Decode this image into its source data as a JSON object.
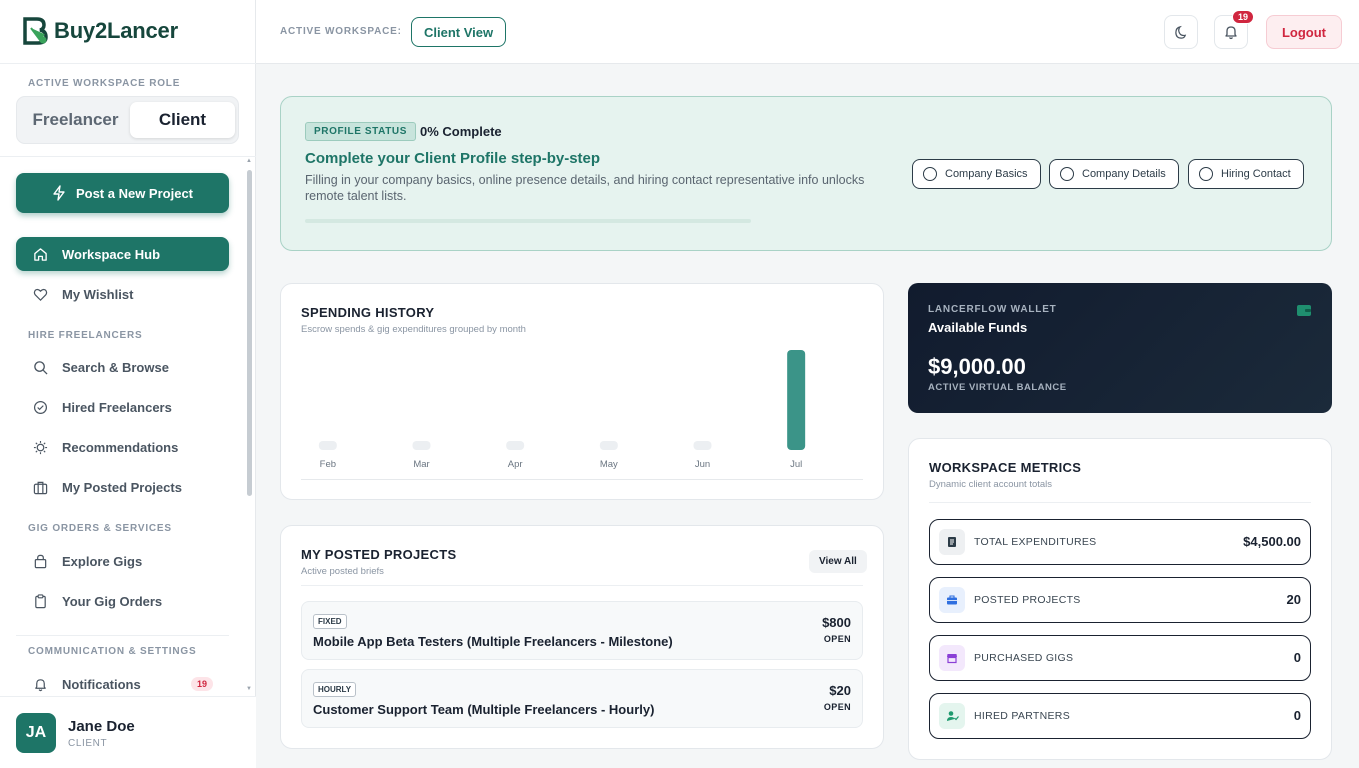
{
  "brand": {
    "name": "Buy2Lancer"
  },
  "sidebar": {
    "role_label": "ACTIVE WORKSPACE ROLE",
    "roles": [
      "Freelancer",
      "Client"
    ],
    "active_role": "Client",
    "post_project": "Post a New Project",
    "items": [
      {
        "label": "Workspace Hub",
        "icon": "home-icon",
        "active": true
      },
      {
        "label": "My Wishlist",
        "icon": "heart-icon"
      },
      {
        "label": "Search & Browse",
        "icon": "search-icon"
      },
      {
        "label": "Hired Freelancers",
        "icon": "check-circle-icon"
      },
      {
        "label": "Recommendations",
        "icon": "lightbulb-icon"
      },
      {
        "label": "My Posted Projects",
        "icon": "briefcase-icon"
      },
      {
        "label": "Explore Gigs",
        "icon": "shopping-bag-icon"
      },
      {
        "label": "Your Gig Orders",
        "icon": "clipboard-icon"
      },
      {
        "label": "Notifications",
        "icon": "bell-icon",
        "badge": "19"
      }
    ],
    "sections": {
      "hire": "HIRE FREELANCERS",
      "gig": "GIG ORDERS & SERVICES",
      "comm": "COMMUNICATION & SETTINGS"
    },
    "user": {
      "initials": "JA",
      "name": "Jane Doe",
      "role": "CLIENT"
    }
  },
  "topbar": {
    "workspace_label": "ACTIVE WORKSPACE:",
    "workspace_value": "Client View",
    "notification_count": "19",
    "logout": "Logout"
  },
  "profile": {
    "tag": "PROFILE STATUS",
    "percent": "0% Complete",
    "progress": 0,
    "title": "Complete your Client Profile step-by-step",
    "description": "Filling in your company basics, online presence details, and hiring contact representative info unlocks remote talent lists.",
    "steps": [
      "Company Basics",
      "Company Details",
      "Hiring Contact"
    ]
  },
  "spending": {
    "title": "SPENDING HISTORY",
    "subtitle": "Escrow spends & gig expenditures grouped by month"
  },
  "chart_data": {
    "type": "bar",
    "categories": [
      "Feb",
      "Mar",
      "Apr",
      "May",
      "Jun",
      "Jul"
    ],
    "values": [
      0,
      0,
      0,
      0,
      0,
      4500
    ],
    "title": "SPENDING HISTORY",
    "colors": {
      "bar": "#3b9488",
      "empty": "#eceff2"
    }
  },
  "projects": {
    "title": "MY POSTED PROJECTS",
    "subtitle": "Active posted briefs",
    "view_all": "View All",
    "items": [
      {
        "type": "FIXED",
        "name": "Mobile App Beta Testers (Multiple Freelancers - Milestone)",
        "price": "$800",
        "status": "OPEN"
      },
      {
        "type": "HOURLY",
        "name": "Customer Support Team (Multiple Freelancers - Hourly)",
        "price": "$20",
        "status": "OPEN"
      }
    ]
  },
  "wallet": {
    "label": "LANCERFLOW WALLET",
    "sub": "Available Funds",
    "amount": "$9,000.00",
    "balance_label": "ACTIVE VIRTUAL BALANCE"
  },
  "metrics": {
    "title": "WORKSPACE METRICS",
    "subtitle": "Dynamic client account totals",
    "items": [
      {
        "label": "TOTAL EXPENDITURES",
        "value": "$4,500.00",
        "icon": "receipt-icon",
        "color": "#2c3b47"
      },
      {
        "label": "POSTED PROJECTS",
        "value": "20",
        "icon": "briefcase-icon",
        "color": "#2f6fe0"
      },
      {
        "label": "PURCHASED GIGS",
        "value": "0",
        "icon": "store-icon",
        "color": "#8a3fd6"
      },
      {
        "label": "HIRED PARTNERS",
        "value": "0",
        "icon": "user-check-icon",
        "color": "#1e9a6e"
      }
    ]
  }
}
